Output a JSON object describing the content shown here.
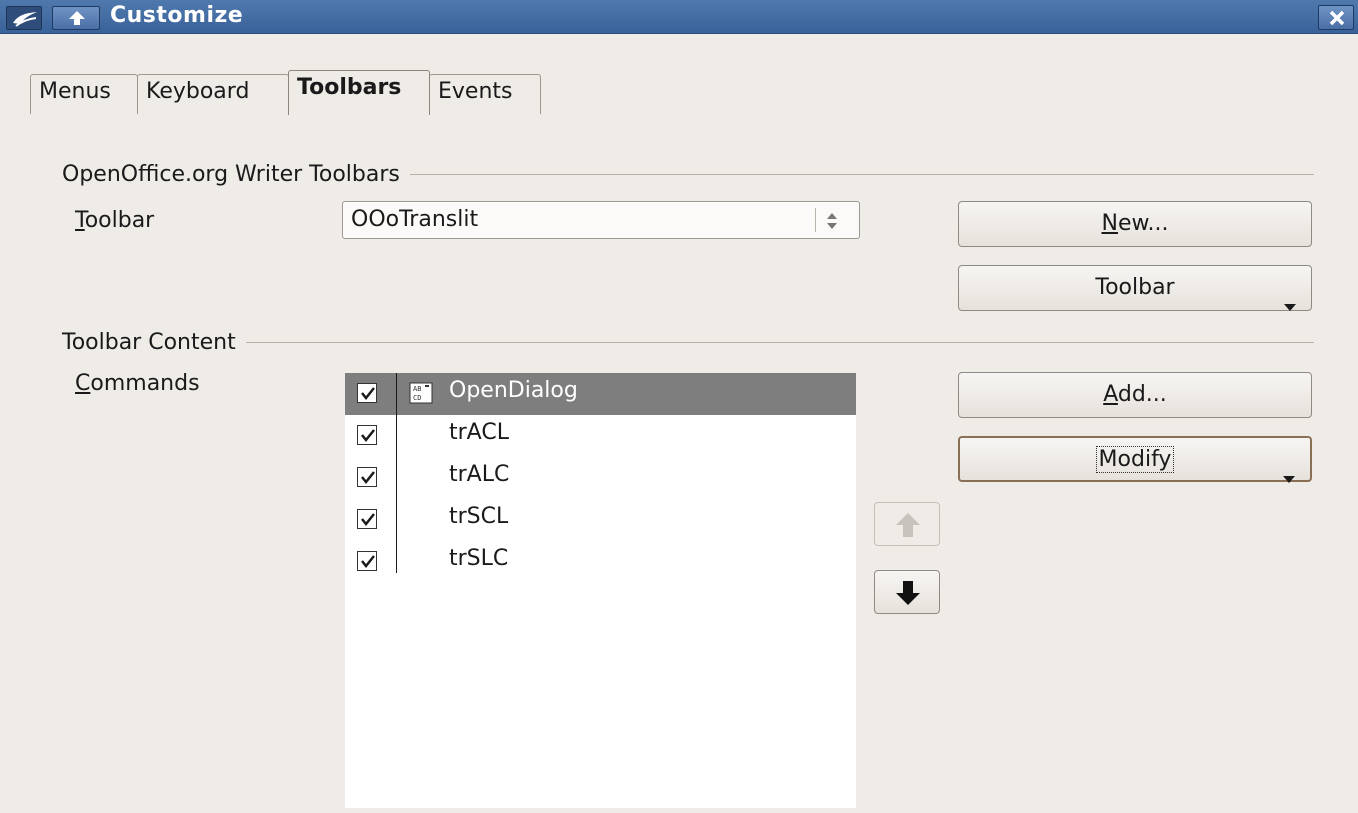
{
  "window": {
    "title": "Customize",
    "icons": {
      "app": "openoffice-app-icon",
      "up": "up-arrow-icon",
      "close": "close-icon"
    }
  },
  "tabs": [
    {
      "label": "Menus",
      "active": false
    },
    {
      "label": "Keyboard",
      "active": false
    },
    {
      "label": "Toolbars",
      "active": true
    },
    {
      "label": "Events",
      "active": false
    }
  ],
  "toolbars_section": {
    "heading": "OpenOffice.org Writer Toolbars",
    "toolbar_label_accel": "T",
    "toolbar_label_rest": "oolbar",
    "toolbar_value": "OOoTranslit",
    "new_button_accel": "N",
    "new_button_rest": "ew...",
    "toolbar_menu_button": "Toolbar"
  },
  "content_section": {
    "heading": "Toolbar Content",
    "commands_label_accel": "C",
    "commands_label_rest": "ommands",
    "commands": [
      {
        "label": "OpenDialog",
        "checked": true,
        "selected": true,
        "icon": "abcd-macro-icon"
      },
      {
        "label": "trACL",
        "checked": true,
        "selected": false
      },
      {
        "label": "trALC",
        "checked": true,
        "selected": false
      },
      {
        "label": "trSCL",
        "checked": true,
        "selected": false
      },
      {
        "label": "trSLC",
        "checked": true,
        "selected": false
      }
    ],
    "add_button_accel": "A",
    "add_button_rest": "dd...",
    "modify_button": "Modify",
    "move_up_enabled": false,
    "move_down_enabled": true
  },
  "colors": {
    "titlebar": "#3a629a",
    "background": "#efebe7",
    "selection": "#7e7e7e"
  }
}
